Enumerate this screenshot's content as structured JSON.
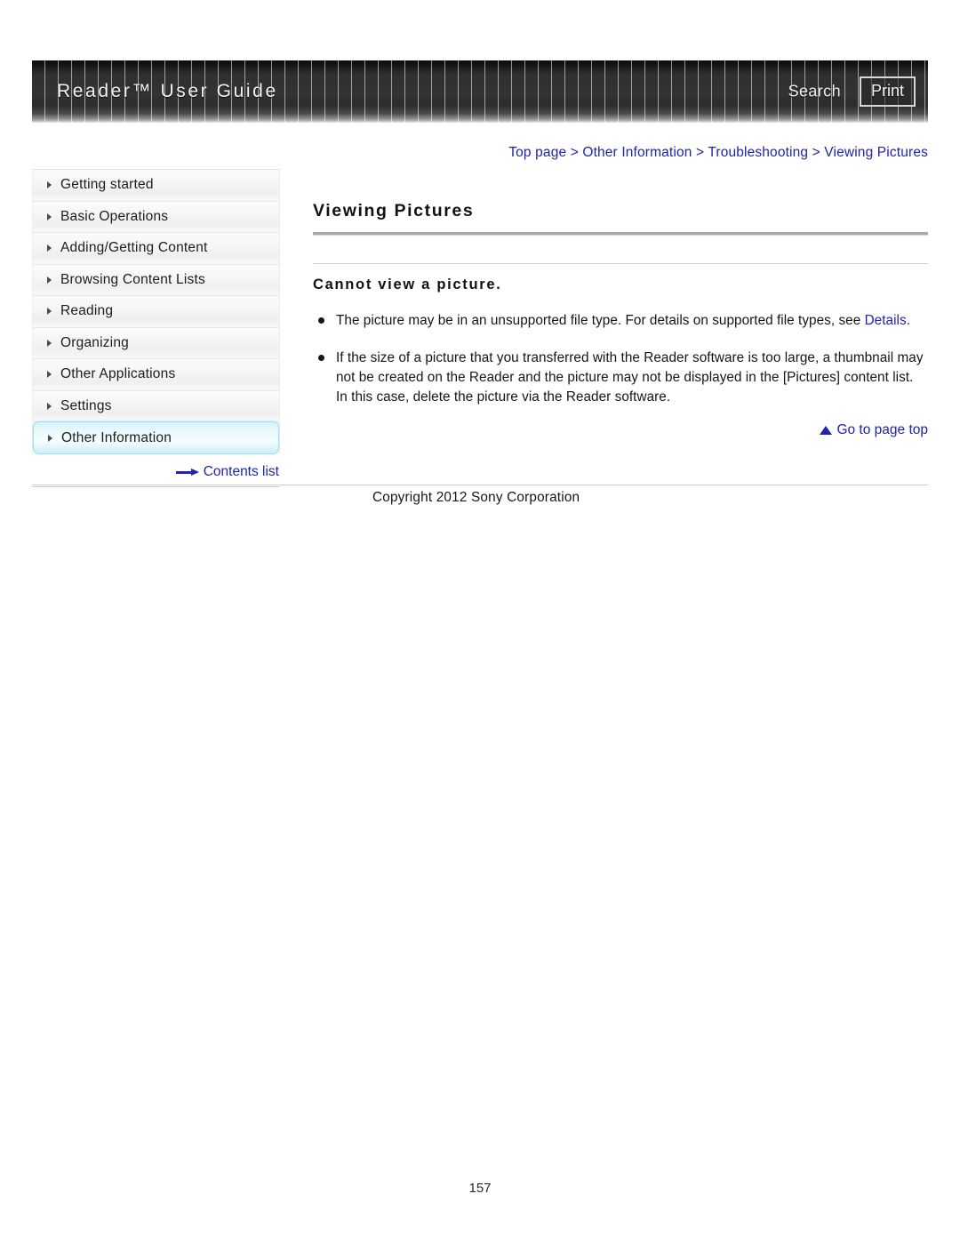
{
  "header": {
    "title": "Reader™ User Guide",
    "search_label": "Search",
    "print_label": "Print"
  },
  "breadcrumb": {
    "text": "Top page > Other Information > Troubleshooting > Viewing Pictures"
  },
  "sidebar": {
    "items": [
      {
        "label": "Getting started",
        "selected": false
      },
      {
        "label": "Basic Operations",
        "selected": false
      },
      {
        "label": "Adding/Getting Content",
        "selected": false
      },
      {
        "label": "Browsing Content Lists",
        "selected": false
      },
      {
        "label": "Reading",
        "selected": false
      },
      {
        "label": "Organizing",
        "selected": false
      },
      {
        "label": "Other Applications",
        "selected": false
      },
      {
        "label": "Settings",
        "selected": false
      },
      {
        "label": "Other Information",
        "selected": true
      }
    ],
    "contents_list_label": "Contents list"
  },
  "main": {
    "page_title": "Viewing Pictures",
    "section_title": "Cannot view a picture.",
    "bullets": [
      {
        "text_before": "The picture may be in an unsupported file type. For details on supported file types, see ",
        "link_text": "Details",
        "text_after": "."
      },
      {
        "text_before": "If the size of a picture that you transferred with the Reader software is too large, a thumbnail may not be created on the Reader and the picture may not be displayed in the [Pictures] content list. In this case, delete the picture via the Reader software.",
        "link_text": "",
        "text_after": ""
      }
    ],
    "go_to_page_top_label": "Go to page top"
  },
  "footer": {
    "copyright": "Copyright 2012 Sony Corporation",
    "page_number": "157"
  },
  "colors": {
    "link_blue": "#2222aa",
    "header_dark": "#2f2f2f",
    "selected_cyan": "#d9f2f8",
    "rule_gray": "#a9a9a9"
  }
}
